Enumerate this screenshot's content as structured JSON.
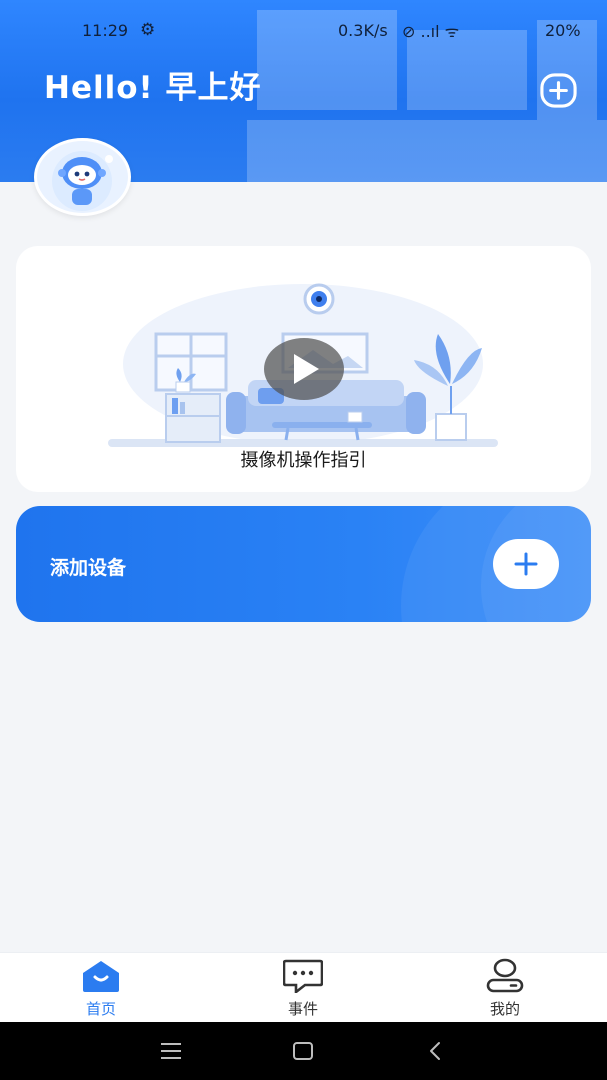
{
  "status_bar": {
    "time": "11:29",
    "gear_glyph": "⚙",
    "network_speed": "0.3K/s",
    "icons_text": "⊘ ..ıl ᯤ",
    "battery": "20%"
  },
  "header": {
    "greeting": "Hello! 早上好"
  },
  "guide_card": {
    "label": "摄像机操作指引"
  },
  "add_device_card": {
    "label": "添加设备"
  },
  "tabbar": {
    "tabs": [
      {
        "label": "首页",
        "icon": "home-icon",
        "active": true
      },
      {
        "label": "事件",
        "icon": "chat-icon",
        "active": false
      },
      {
        "label": "我的",
        "icon": "user-icon",
        "active": false
      }
    ]
  },
  "system_nav": {
    "icons": [
      "menu-icon",
      "home-square-icon",
      "back-icon"
    ]
  },
  "colors": {
    "primary": "#2b7cf0",
    "header_bg": "#2f86ff",
    "page_bg": "#f3f5f8"
  }
}
